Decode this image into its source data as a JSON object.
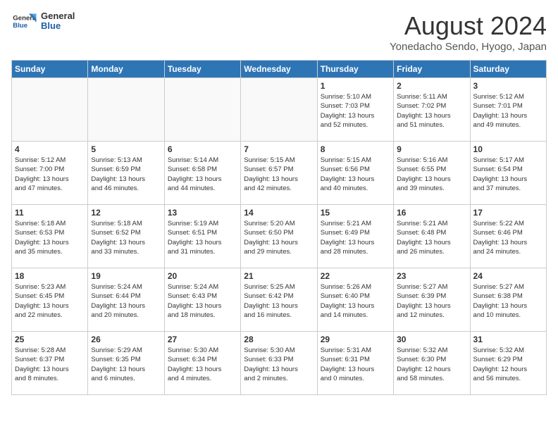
{
  "header": {
    "logo_line1": "General",
    "logo_line2": "Blue",
    "month_year": "August 2024",
    "location": "Yonedacho Sendo, Hyogo, Japan"
  },
  "days_of_week": [
    "Sunday",
    "Monday",
    "Tuesday",
    "Wednesday",
    "Thursday",
    "Friday",
    "Saturday"
  ],
  "weeks": [
    [
      {
        "day": "",
        "info": ""
      },
      {
        "day": "",
        "info": ""
      },
      {
        "day": "",
        "info": ""
      },
      {
        "day": "",
        "info": ""
      },
      {
        "day": "1",
        "info": "Sunrise: 5:10 AM\nSunset: 7:03 PM\nDaylight: 13 hours\nand 52 minutes."
      },
      {
        "day": "2",
        "info": "Sunrise: 5:11 AM\nSunset: 7:02 PM\nDaylight: 13 hours\nand 51 minutes."
      },
      {
        "day": "3",
        "info": "Sunrise: 5:12 AM\nSunset: 7:01 PM\nDaylight: 13 hours\nand 49 minutes."
      }
    ],
    [
      {
        "day": "4",
        "info": "Sunrise: 5:12 AM\nSunset: 7:00 PM\nDaylight: 13 hours\nand 47 minutes."
      },
      {
        "day": "5",
        "info": "Sunrise: 5:13 AM\nSunset: 6:59 PM\nDaylight: 13 hours\nand 46 minutes."
      },
      {
        "day": "6",
        "info": "Sunrise: 5:14 AM\nSunset: 6:58 PM\nDaylight: 13 hours\nand 44 minutes."
      },
      {
        "day": "7",
        "info": "Sunrise: 5:15 AM\nSunset: 6:57 PM\nDaylight: 13 hours\nand 42 minutes."
      },
      {
        "day": "8",
        "info": "Sunrise: 5:15 AM\nSunset: 6:56 PM\nDaylight: 13 hours\nand 40 minutes."
      },
      {
        "day": "9",
        "info": "Sunrise: 5:16 AM\nSunset: 6:55 PM\nDaylight: 13 hours\nand 39 minutes."
      },
      {
        "day": "10",
        "info": "Sunrise: 5:17 AM\nSunset: 6:54 PM\nDaylight: 13 hours\nand 37 minutes."
      }
    ],
    [
      {
        "day": "11",
        "info": "Sunrise: 5:18 AM\nSunset: 6:53 PM\nDaylight: 13 hours\nand 35 minutes."
      },
      {
        "day": "12",
        "info": "Sunrise: 5:18 AM\nSunset: 6:52 PM\nDaylight: 13 hours\nand 33 minutes."
      },
      {
        "day": "13",
        "info": "Sunrise: 5:19 AM\nSunset: 6:51 PM\nDaylight: 13 hours\nand 31 minutes."
      },
      {
        "day": "14",
        "info": "Sunrise: 5:20 AM\nSunset: 6:50 PM\nDaylight: 13 hours\nand 29 minutes."
      },
      {
        "day": "15",
        "info": "Sunrise: 5:21 AM\nSunset: 6:49 PM\nDaylight: 13 hours\nand 28 minutes."
      },
      {
        "day": "16",
        "info": "Sunrise: 5:21 AM\nSunset: 6:48 PM\nDaylight: 13 hours\nand 26 minutes."
      },
      {
        "day": "17",
        "info": "Sunrise: 5:22 AM\nSunset: 6:46 PM\nDaylight: 13 hours\nand 24 minutes."
      }
    ],
    [
      {
        "day": "18",
        "info": "Sunrise: 5:23 AM\nSunset: 6:45 PM\nDaylight: 13 hours\nand 22 minutes."
      },
      {
        "day": "19",
        "info": "Sunrise: 5:24 AM\nSunset: 6:44 PM\nDaylight: 13 hours\nand 20 minutes."
      },
      {
        "day": "20",
        "info": "Sunrise: 5:24 AM\nSunset: 6:43 PM\nDaylight: 13 hours\nand 18 minutes."
      },
      {
        "day": "21",
        "info": "Sunrise: 5:25 AM\nSunset: 6:42 PM\nDaylight: 13 hours\nand 16 minutes."
      },
      {
        "day": "22",
        "info": "Sunrise: 5:26 AM\nSunset: 6:40 PM\nDaylight: 13 hours\nand 14 minutes."
      },
      {
        "day": "23",
        "info": "Sunrise: 5:27 AM\nSunset: 6:39 PM\nDaylight: 13 hours\nand 12 minutes."
      },
      {
        "day": "24",
        "info": "Sunrise: 5:27 AM\nSunset: 6:38 PM\nDaylight: 13 hours\nand 10 minutes."
      }
    ],
    [
      {
        "day": "25",
        "info": "Sunrise: 5:28 AM\nSunset: 6:37 PM\nDaylight: 13 hours\nand 8 minutes."
      },
      {
        "day": "26",
        "info": "Sunrise: 5:29 AM\nSunset: 6:35 PM\nDaylight: 13 hours\nand 6 minutes."
      },
      {
        "day": "27",
        "info": "Sunrise: 5:30 AM\nSunset: 6:34 PM\nDaylight: 13 hours\nand 4 minutes."
      },
      {
        "day": "28",
        "info": "Sunrise: 5:30 AM\nSunset: 6:33 PM\nDaylight: 13 hours\nand 2 minutes."
      },
      {
        "day": "29",
        "info": "Sunrise: 5:31 AM\nSunset: 6:31 PM\nDaylight: 13 hours\nand 0 minutes."
      },
      {
        "day": "30",
        "info": "Sunrise: 5:32 AM\nSunset: 6:30 PM\nDaylight: 12 hours\nand 58 minutes."
      },
      {
        "day": "31",
        "info": "Sunrise: 5:32 AM\nSunset: 6:29 PM\nDaylight: 12 hours\nand 56 minutes."
      }
    ]
  ]
}
